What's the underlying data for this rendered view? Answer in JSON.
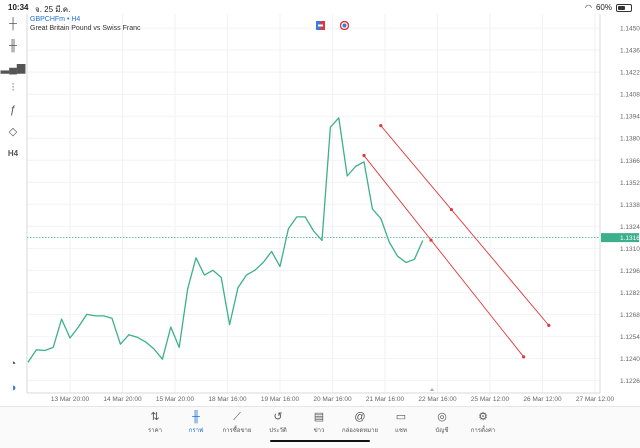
{
  "status": {
    "time": "10:34",
    "date": "จ. 25 มี.ค.",
    "battery": "60%",
    "battery_level": 0.6
  },
  "chart_header": {
    "symbol": "GBPCHFm",
    "timeframe": "H4",
    "description": "Great Britain Pound vs Swiss Franc"
  },
  "toolbar": [
    {
      "name": "crosshair-icon",
      "glyph": "┼"
    },
    {
      "name": "candlestick-icon",
      "glyph": "╫"
    },
    {
      "name": "bar-chart-icon",
      "glyph": "▂▄▆"
    },
    {
      "name": "indicators-icon",
      "glyph": "⫶"
    },
    {
      "name": "function-icon",
      "glyph": "ƒ"
    },
    {
      "name": "objects-icon",
      "glyph": "◇"
    },
    {
      "name": "timeframe-button",
      "glyph": "H4"
    }
  ],
  "left_bottom_icons": [
    {
      "name": "trade-levels-icon",
      "glyph": "◔"
    },
    {
      "name": "color-scheme-icon",
      "glyph": "◑"
    }
  ],
  "chart_data": {
    "type": "line",
    "symbol": "GBPCHFm",
    "timeframe": "H4",
    "x_tick_labels": [
      "13 Mar 20:00",
      "14 Mar 20:00",
      "15 Mar 20:00",
      "18 Mar 16:00",
      "19 Mar 16:00",
      "20 Mar 16:00",
      "21 Mar 16:00",
      "22 Mar 16:00",
      "25 Mar 12:00",
      "26 Mar 12:00",
      "27 Mar 12:00"
    ],
    "y_tick_labels": [
      "1.14500",
      "1.14360",
      "1.14220",
      "1.14080",
      "1.13940",
      "1.13800",
      "1.13660",
      "1.13520",
      "1.13380",
      "1.13240",
      "1.13100",
      "1.12960",
      "1.12820",
      "1.12680",
      "1.12540",
      "1.12400",
      "1.12260"
    ],
    "ylim": [
      1.1218,
      1.1459
    ],
    "values": [
      1.12375,
      1.12455,
      1.1245,
      1.1247,
      1.1265,
      1.1253,
      1.126,
      1.1268,
      1.1267,
      1.1267,
      1.12655,
      1.1249,
      1.1255,
      1.12535,
      1.12505,
      1.1246,
      1.12395,
      1.126,
      1.1247,
      1.1284,
      1.1304,
      1.1293,
      1.1296,
      1.12915,
      1.12615,
      1.1285,
      1.1293,
      1.1296,
      1.1301,
      1.1308,
      1.12985,
      1.13225,
      1.133,
      1.133,
      1.1321,
      1.1315,
      1.1387,
      1.1393,
      1.1356,
      1.1362,
      1.1365,
      1.1335,
      1.1329,
      1.1314,
      1.1305,
      1.1301,
      1.1303,
      1.1315
    ],
    "current_price": "1.13168",
    "current_price_value": 1.13168,
    "channel_lines": [
      {
        "x_start": 40,
        "y_start": 1.1369,
        "x_end": 59,
        "y_end": 1.1241
      },
      {
        "x_start": 42,
        "y_start": 1.1388,
        "x_end": 62,
        "y_end": 1.1261
      }
    ],
    "colors": {
      "line": "#3cb08c",
      "price_line": "#3cb08c",
      "price_badge": "#3cb08c",
      "channel": "#e0373c",
      "grid": "#f2f2f2",
      "axis": "#d8d8d8"
    }
  },
  "bottom_nav": [
    {
      "name": "nav-quotes",
      "icon": "quotes-icon",
      "glyph": "⇅",
      "label": "ราคา",
      "active": false
    },
    {
      "name": "nav-chart",
      "icon": "chart-icon",
      "glyph": "╫",
      "label": "กราฟ",
      "active": true
    },
    {
      "name": "nav-trade",
      "icon": "trade-icon",
      "glyph": "⟋",
      "label": "การซื้อขาย",
      "active": false
    },
    {
      "name": "nav-history",
      "icon": "history-icon",
      "glyph": "↺",
      "label": "ประวัติ",
      "active": false
    },
    {
      "name": "nav-news",
      "icon": "news-icon",
      "glyph": "▤",
      "label": "ข่าว",
      "active": false
    },
    {
      "name": "nav-mailbox",
      "icon": "mailbox-icon",
      "glyph": "@",
      "label": "กล่องจดหมาย",
      "active": false
    },
    {
      "name": "nav-chat",
      "icon": "chat-icon",
      "glyph": "▭",
      "label": "แชท",
      "active": false
    },
    {
      "name": "nav-accounts",
      "icon": "accounts-icon",
      "glyph": "◎",
      "label": "บัญชี",
      "active": false
    },
    {
      "name": "nav-settings",
      "icon": "settings-icon",
      "glyph": "⚙",
      "label": "การตั้งค่า",
      "active": false
    }
  ]
}
